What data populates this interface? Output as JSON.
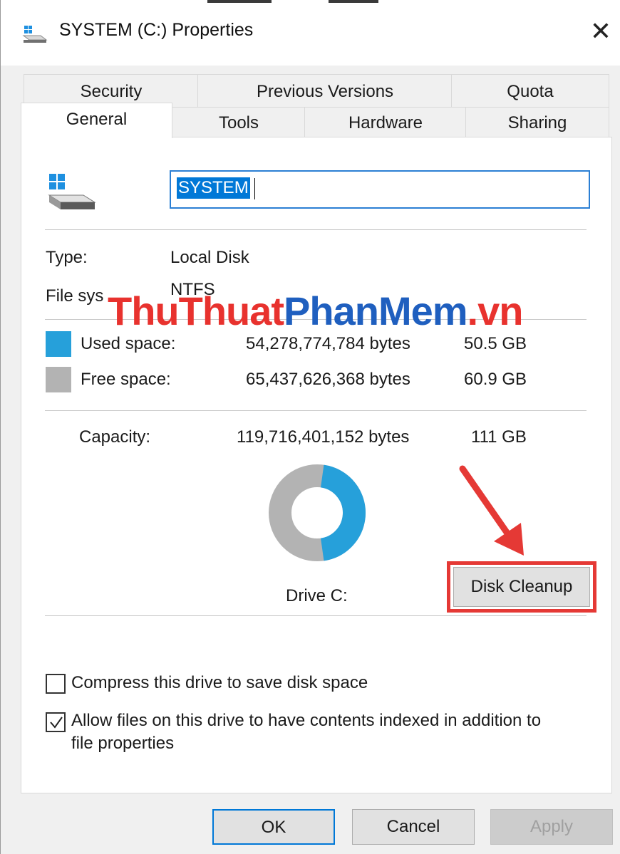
{
  "window": {
    "title": "SYSTEM (C:) Properties"
  },
  "tabs_row1": [
    "Security",
    "Previous Versions",
    "Quota"
  ],
  "tabs_row2": [
    "General",
    "Tools",
    "Hardware",
    "Sharing"
  ],
  "general": {
    "name_value": "SYSTEM",
    "type_label": "Type:",
    "type_value": "Local Disk",
    "fs_label": "File sys",
    "fs_value": "NTFS",
    "used_label": "Used space:",
    "used_bytes": "54,278,774,784 bytes",
    "used_gb": "50.5 GB",
    "free_label": "Free space:",
    "free_bytes": "65,437,626,368 bytes",
    "free_gb": "60.9 GB",
    "capacity_label": "Capacity:",
    "capacity_bytes": "119,716,401,152 bytes",
    "capacity_gb": "111 GB",
    "drive_label": "Drive C:",
    "disk_cleanup": "Disk Cleanup",
    "compress_label": "Compress this drive to save disk space",
    "compress_checked": false,
    "index_label_line1": "Allow files on this drive to have contents indexed in addition to",
    "index_label_line2": "file properties",
    "index_checked": true
  },
  "usage": {
    "used_fraction": 0.455,
    "used_color": "#26a0da",
    "free_color": "#b3b3b3"
  },
  "watermark": {
    "part1": "ThuThuat",
    "part2": "PhanMem",
    "part3": ".vn"
  },
  "buttons": {
    "ok": "OK",
    "cancel": "Cancel",
    "apply": "Apply"
  },
  "icons": [
    "drive-icon",
    "close-icon",
    "checkmark-icon",
    "arrow-annotation"
  ]
}
